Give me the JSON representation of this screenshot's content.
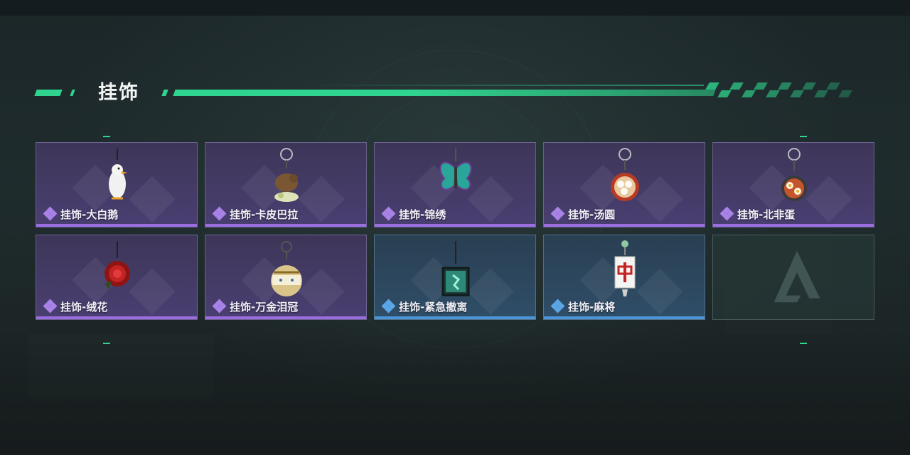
{
  "header": {
    "title": "挂饰"
  },
  "items": [
    {
      "label": "挂饰-大白鹅",
      "rarity": "purple",
      "icon": "goose-charm-icon"
    },
    {
      "label": "挂饰-卡皮巴拉",
      "rarity": "purple",
      "icon": "capybara-charm-icon"
    },
    {
      "label": "挂饰-锦绣",
      "rarity": "purple",
      "icon": "butterfly-charm-icon"
    },
    {
      "label": "挂饰-汤圆",
      "rarity": "purple",
      "icon": "tangyuan-bowl-charm-icon"
    },
    {
      "label": "挂饰-北非蛋",
      "rarity": "purple",
      "icon": "shakshuka-pan-charm-icon"
    },
    {
      "label": "挂饰-绒花",
      "rarity": "purple",
      "icon": "red-flower-charm-icon"
    },
    {
      "label": "挂饰-万金泪冠",
      "rarity": "purple",
      "icon": "crown-egg-charm-icon"
    },
    {
      "label": "挂饰-紧急撤离",
      "rarity": "blue",
      "icon": "exit-sign-charm-icon"
    },
    {
      "label": "挂饰-麻将",
      "rarity": "blue",
      "icon": "mahjong-tile-charm-icon"
    },
    {
      "label": "",
      "rarity": "empty",
      "icon": "empty-slot-logo-icon"
    }
  ],
  "colors": {
    "accent": "#2fd48e",
    "purple_rarity": "#9b6ee0",
    "blue_rarity": "#4b95d8"
  }
}
